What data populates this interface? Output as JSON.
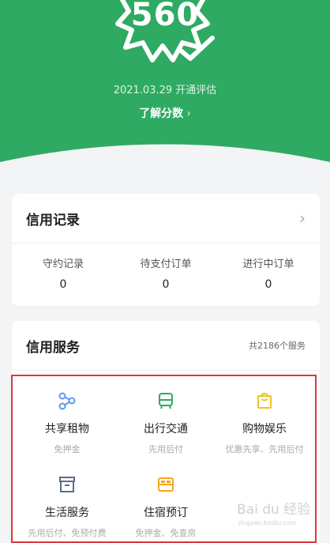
{
  "hero": {
    "score": "560",
    "date_text": "2021.03.29 开通评估",
    "learn_label": "了解分数",
    "learn_chevron": "›"
  },
  "record": {
    "title": "信用记录",
    "arrow": "›",
    "stats": [
      {
        "label": "守约记录",
        "value": "0"
      },
      {
        "label": "待支付订单",
        "value": "0"
      },
      {
        "label": "进行中订单",
        "value": "0"
      }
    ]
  },
  "service": {
    "title": "信用服务",
    "count_text": "共2186个服务",
    "items": [
      {
        "name": "共享租物",
        "sub": "免押金",
        "icon": "share-icon"
      },
      {
        "name": "出行交通",
        "sub": "先用后付",
        "icon": "bus-icon"
      },
      {
        "name": "购物娱乐",
        "sub": "优惠先享、先用后付",
        "icon": "shopping-bag-icon"
      },
      {
        "name": "生活服务",
        "sub": "先用后付、免预付费",
        "icon": "archive-box-icon"
      },
      {
        "name": "住宿预订",
        "sub": "免押金、免查房",
        "icon": "bed-icon"
      }
    ]
  },
  "watermark": {
    "text": "Bai du 经验",
    "sub": "jingyan.baidu.com"
  },
  "colors": {
    "brand": "#2eaa62",
    "highlight": "#d9363e",
    "icon_blue": "#5a9be6",
    "icon_green": "#2eaa62",
    "icon_yellow": "#f0c027",
    "icon_slate": "#5a6d8c",
    "icon_orange": "#f5a623"
  }
}
